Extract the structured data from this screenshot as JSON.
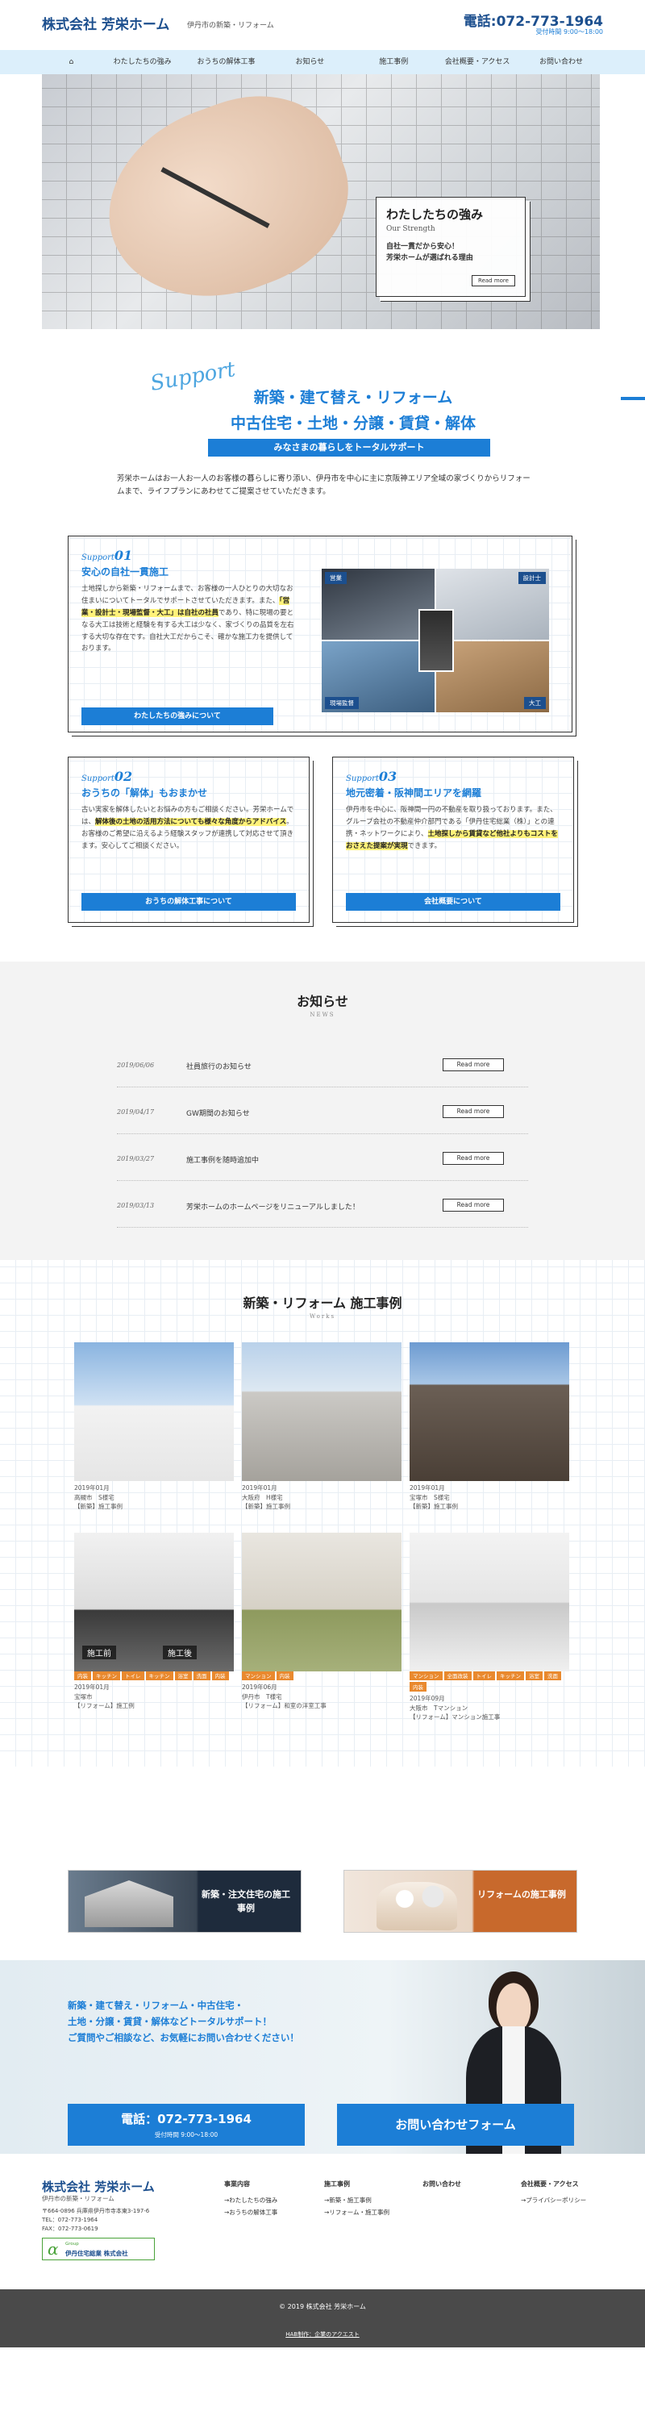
{
  "header": {
    "logo": "株式会社 芳栄ホーム",
    "logo_sub": "伊丹市の新築・リフォーム",
    "tel": "電話:072-773-1964",
    "hours": "受付時間 9:00～18:00"
  },
  "nav": {
    "home_icon": "⌂",
    "items": [
      "わたしたちの強み",
      "おうちの解体工事",
      "お知らせ",
      "施工事例",
      "会社概要・アクセス",
      "お問い合わせ"
    ]
  },
  "hero": {
    "title": "わたしたちの強み",
    "title_en": "Our Strength",
    "desc_line1": "自社一貫だから安心！",
    "desc_line2": "芳栄ホームが選ばれる理由",
    "button": "Read more"
  },
  "intro": {
    "script": "Support",
    "heading1": "新築・建て替え・リフォーム",
    "heading2": "中古住宅・土地・分譲・賃貸・解体",
    "bar": "みなさまの暮らしをトータルサポート",
    "text": "芳栄ホームはお一人お一人のお客様の暮らしに寄り添い、伊丹市を中心に主に京阪神エリア全域の家づくりからリフォームまで、ライフプランにあわせてご提案させていただきます。"
  },
  "support1": {
    "label": "Support",
    "num": "01",
    "title": "安心の自社一貫施工",
    "text_a": "土地探しから新築・リフォームまで、お客様の一人ひとりの大切なお住まいについてトータルでサポートさせていただきます。また、",
    "text_hl": "「営業・設計士・現場監督・大工」は自社の社員",
    "text_b": "であり、特に現場の要となる大工は技術と経験を有する大工は少なく、家づくりの品質を左右する大切な存在です。自社大工だからこそ、確かな施工力を提供しております。",
    "button": "わたしたちの強みについて",
    "badges": [
      "営業",
      "設計士",
      "現場監督",
      "大工"
    ]
  },
  "support2": {
    "label": "Support",
    "num": "02",
    "title": "おうちの「解体」もおまかせ",
    "text_a": "古い実家を解体したいとお悩みの方もご相談ください。芳栄ホームでは、",
    "text_hl": "解体後の土地の活用方法についても様々な角度からアドバイス",
    "text_b": "。お客様のご希望に沿えるよう経験スタッフが連携して対応させて頂きます。安心してご相談ください。",
    "button": "おうちの解体工事について"
  },
  "support3": {
    "label": "Support",
    "num": "03",
    "title": "地元密着・阪神間エリアを網羅",
    "text_a": "伊丹市を中心に、阪神間一円の不動産を取り扱っております。また、グループ会社の不動産仲介部門である「伊丹住宅総業（株）」との連携・ネットワークにより、",
    "text_hl": "土地探しから賃貸など他社よりもコストをおさえた提案が実現",
    "text_b": "できます。",
    "button": "会社概要について"
  },
  "news": {
    "title": "お知らせ",
    "sub": "NEWS",
    "items": [
      {
        "date": "2019/06/06",
        "text": "社員旅行のお知らせ",
        "button": "Read more"
      },
      {
        "date": "2019/04/17",
        "text": "GW期間のお知らせ",
        "button": "Read more"
      },
      {
        "date": "2019/03/27",
        "text": "施工事例を随時追加中",
        "button": "Read more"
      },
      {
        "date": "2019/03/13",
        "text": "芳栄ホームのホームページをリニューアルしました！",
        "button": "Read more"
      }
    ]
  },
  "works": {
    "title": "新築・リフォーム 施工事例",
    "sub": "Works",
    "items": [
      {
        "date": "2019年01月",
        "place": "高槻市　S様宅",
        "category": "【新築】施工事例",
        "tags": []
      },
      {
        "date": "2019年01月",
        "place": "大阪府　H様宅",
        "category": "【新築】施工事例",
        "tags": []
      },
      {
        "date": "2019年01月",
        "place": "宝塚市　S様宅",
        "category": "【新築】施工事例",
        "tags": []
      },
      {
        "date": "2019年01月",
        "place": "宝塚市",
        "category": "【リフォーム】施工例",
        "tags": [
          "内装",
          "キッチン",
          "トイレ",
          "キッチン",
          "浴室",
          "洗面",
          "内装"
        ],
        "before": "施工前",
        "after": "施工後"
      },
      {
        "date": "2019年06月",
        "place": "伊丹市　T様宅",
        "category": "【リフォーム】和室の洋室工事",
        "tags": [
          "マンション",
          "内装"
        ]
      },
      {
        "date": "2019年09月",
        "place": "大阪市　Tマンション",
        "category": "【リフォーム】マンション施工事",
        "tags": [
          "マンション",
          "全面改装",
          "トイレ",
          "キッチン",
          "浴室",
          "洗面",
          "内装"
        ]
      }
    ]
  },
  "banners": {
    "left": "新築・注文住宅の施工事例",
    "right": "リフォームの施工事例"
  },
  "contact": {
    "line1": "新築・建て替え・リフォーム・中古住宅・",
    "line2": "土地・分譲・賃貸・解体などトータルサポート！",
    "line3": "ご質問やご相談など、お気軽にお問い合わせください！",
    "tel_button": "電話：072-773-1964",
    "tel_hours": "受付時間 9:00～18:00",
    "form_button": "お問い合わせフォーム"
  },
  "footer": {
    "logo": "株式会社 芳栄ホーム",
    "logo_sub": "伊丹市の新築・リフォーム",
    "address": "〒664-0896 兵庫県伊丹市寺本東3-197-6",
    "tel": "TEL：072-773-1964",
    "fax": "FAX：072-773-0619",
    "badge_mark": "α",
    "badge_small": "Group",
    "badge_text": "伊丹住宅総業 株式会社",
    "cols": [
      {
        "head": "事業内容",
        "items": [
          "→わたしたちの強み",
          "→おうちの解体工事"
        ]
      },
      {
        "head": "施工事例",
        "items": [
          "→新築・施工事例",
          "→リフォーム・施工事例"
        ]
      },
      {
        "head": "お問い合わせ",
        "items": []
      },
      {
        "head": "会社概要・アクセス",
        "items": [
          "→プライバシーポリシー"
        ]
      }
    ]
  },
  "copyright": {
    "text": "© 2019 株式会社 芳栄ホーム",
    "link": "HAB制作：企業のアクエスト"
  }
}
